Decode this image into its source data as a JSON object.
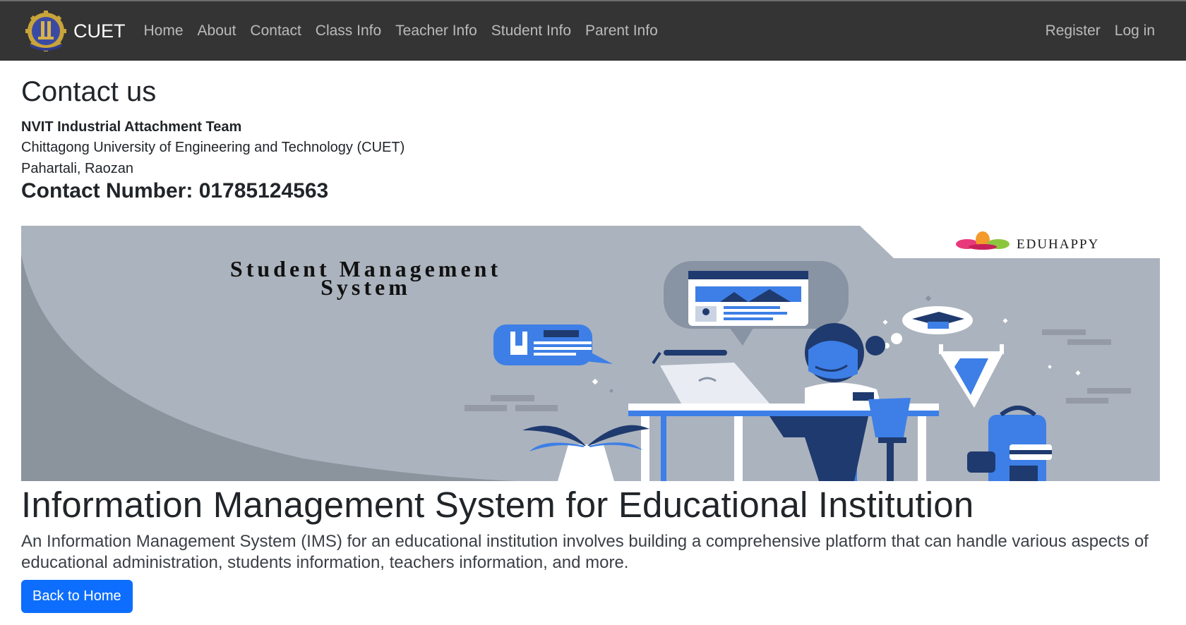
{
  "nav": {
    "brand": "CUET",
    "links": [
      "Home",
      "About",
      "Contact",
      "Class Info",
      "Teacher Info",
      "Student Info",
      "Parent Info"
    ],
    "right": [
      "Register",
      "Log in"
    ]
  },
  "contact": {
    "title": "Contact us",
    "team": "NVIT Industrial Attachment Team",
    "address_line1": "Chittagong University of Engineering and Technology (CUET)",
    "address_line2": "Pahartali, Raozan",
    "phone_label": "Contact Number:",
    "phone_number": "01785124563"
  },
  "banner": {
    "headline_line1": "Student Management",
    "headline_line2": "System",
    "brand": "EDUHAPPY"
  },
  "hero": {
    "title": "Information Management System for Educational Institution",
    "description": "An Information Management System (IMS) for an educational institution involves building a comprehensive platform that can handle various aspects of educational administration, students information, teachers information, and more.",
    "button": "Back to Home"
  },
  "colors": {
    "navbar": "#343434",
    "primary": "#0d6efd",
    "banner_bg": "#abb3be",
    "illustration_blue": "#3d7fe6",
    "illustration_navy": "#1f3a6e"
  }
}
